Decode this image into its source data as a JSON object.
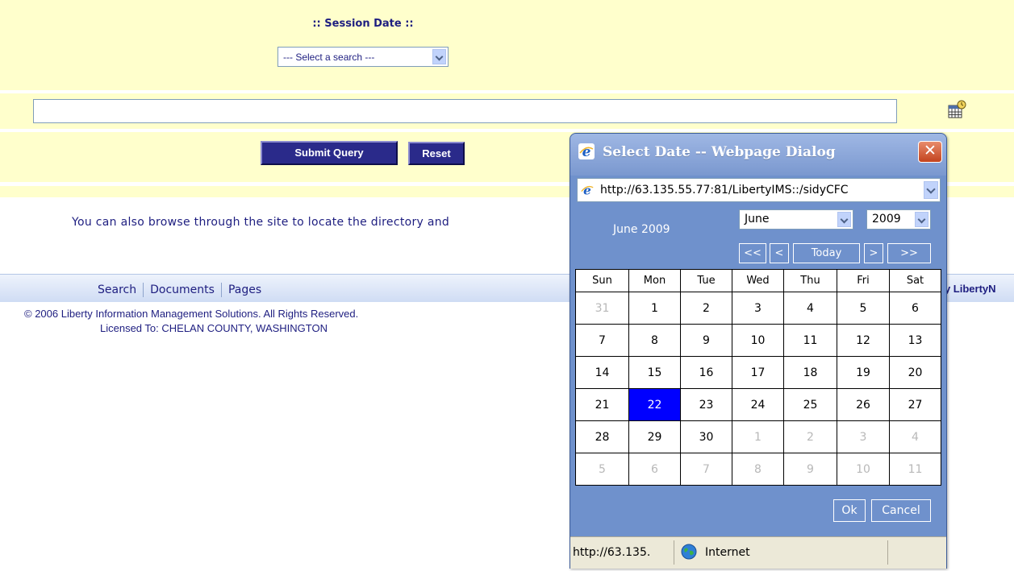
{
  "search_form": {
    "section_title": ":: Session Date ::",
    "search_select_value": "--- Select a search ---",
    "date_input_value": "",
    "submit_label": "Submit Query",
    "reset_label": "Reset"
  },
  "browse_text": "You can also browse through the site to locate the directory and",
  "nav": {
    "links": [
      "Search",
      "Documents",
      "Pages"
    ],
    "right_text": "by LibertyN"
  },
  "footer": {
    "copyright": "© 2006 Liberty Information Management Solutions. All Rights Reserved.",
    "licensed": "Licensed To: CHELAN COUNTY, WASHINGTON"
  },
  "dialog": {
    "title": "Select Date -- Webpage Dialog",
    "close_glyph": "✕",
    "address": "http://63.135.55.77:81/LibertyIMS::/sidyCFC",
    "calendar": {
      "header_label": "June 2009",
      "month_value": "June",
      "year_value": "2009",
      "nav_buttons": [
        "<<",
        "<",
        "Today",
        ">",
        ">>"
      ],
      "weekdays": [
        "Sun",
        "Mon",
        "Tue",
        "Wed",
        "Thu",
        "Fri",
        "Sat"
      ],
      "weeks": [
        [
          "31",
          "1",
          "2",
          "3",
          "4",
          "5",
          "6"
        ],
        [
          "7",
          "8",
          "9",
          "10",
          "11",
          "12",
          "13"
        ],
        [
          "14",
          "15",
          "16",
          "17",
          "18",
          "19",
          "20"
        ],
        [
          "21",
          "22",
          "23",
          "24",
          "25",
          "26",
          "27"
        ],
        [
          "28",
          "29",
          "30",
          "1",
          "2",
          "3",
          "4"
        ],
        [
          "5",
          "6",
          "7",
          "8",
          "9",
          "10",
          "11"
        ]
      ],
      "selected_day": "22",
      "ok_label": "Ok",
      "cancel_label": "Cancel"
    },
    "status": {
      "url": "http://63.135.",
      "zone": "Internet"
    }
  },
  "colors": {
    "form_background": "#ffffcc",
    "dialog_body": "#6f91cc",
    "button_navy": "#2a2a8a",
    "selected_day": "#0000ff",
    "link_text": "#1e1e80"
  },
  "icons": {
    "calendar_picker": "calendar-grid-icon",
    "title_logo": "ie-logo-icon",
    "status_zone": "globe-icon"
  }
}
